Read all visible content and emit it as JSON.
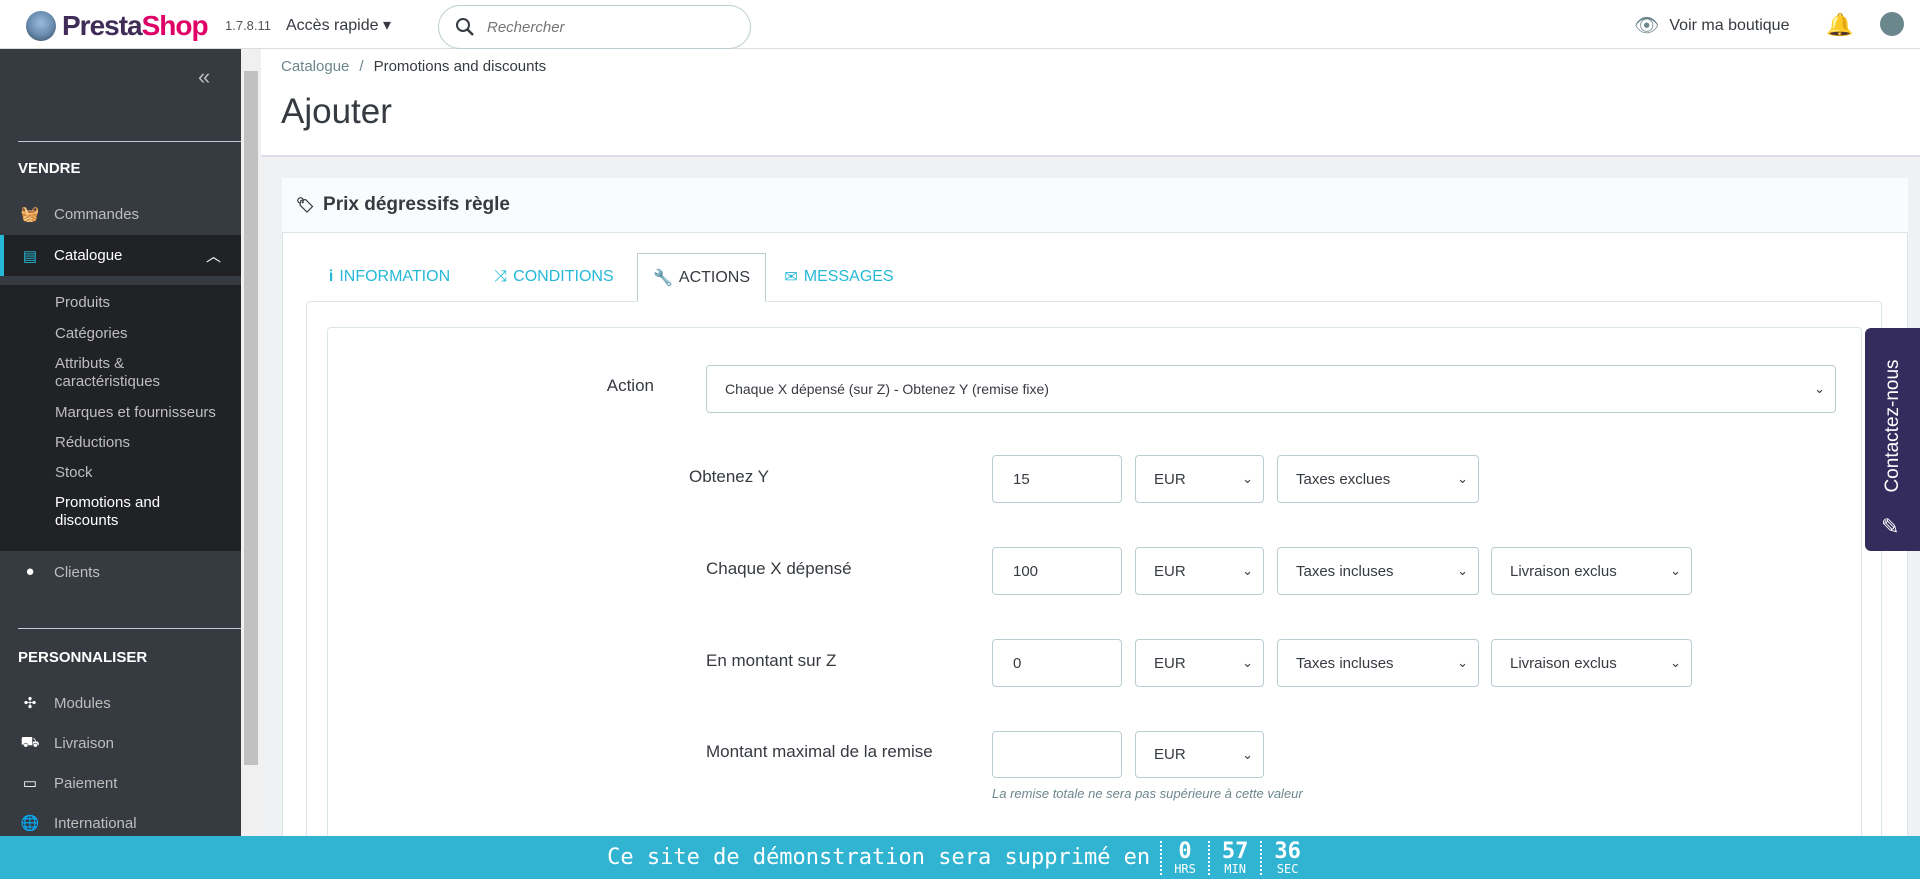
{
  "header": {
    "brand": "PrestaShop",
    "version": "1.7.8.11",
    "quick_access": "Accès rapide",
    "search_placeholder": "Rechercher",
    "view_shop": "Voir ma boutique"
  },
  "sidebar": {
    "sections": [
      "VENDRE",
      "PERSONNALISER"
    ],
    "items": [
      {
        "label": "Commandes",
        "icon": "basket-icon"
      },
      {
        "label": "Catalogue",
        "icon": "store-icon"
      },
      {
        "label": "Clients",
        "icon": "account-icon"
      },
      {
        "label": "Modules",
        "icon": "puzzle-icon"
      },
      {
        "label": "Livraison",
        "icon": "truck-icon"
      },
      {
        "label": "Paiement",
        "icon": "credit-card-icon"
      },
      {
        "label": "International",
        "icon": "globe-icon"
      }
    ],
    "catalogue_sub": [
      "Produits",
      "Catégories",
      "Attributs & caractéristiques",
      "Marques et fournisseurs",
      "Réductions",
      "Stock",
      "Promotions and discounts"
    ]
  },
  "breadcrumb": [
    "Catalogue",
    "Promotions and discounts"
  ],
  "page_title": "Ajouter",
  "card_title": "Prix dégressifs règle",
  "tabs": [
    "INFORMATION",
    "CONDITIONS",
    "ACTIONS",
    "MESSAGES"
  ],
  "form": {
    "action_label": "Action",
    "action_value": "Chaque X dépensé (sur Z) - Obtenez Y (remise fixe)",
    "rows": [
      {
        "label": "Obtenez Y",
        "value": "15",
        "currency": "EUR",
        "tax": "Taxes exclues"
      },
      {
        "label": "Chaque X dépensé",
        "value": "100",
        "currency": "EUR",
        "tax": "Taxes incluses",
        "shipping": "Livraison exclus"
      },
      {
        "label": "En montant sur Z",
        "value": "0",
        "currency": "EUR",
        "tax": "Taxes incluses",
        "shipping": "Livraison exclus"
      },
      {
        "label": "Montant maximal de la remise",
        "value": "",
        "currency": "EUR"
      }
    ],
    "max_help": "La remise totale ne sera pas supérieure à cette valeur"
  },
  "contact": "Contactez-nous",
  "banner": {
    "text": "Ce site de démonstration sera supprimé en",
    "hours": "0",
    "hours_unit": "HRS",
    "minutes": "57",
    "minutes_unit": "MIN",
    "seconds": "36",
    "seconds_unit": "SEC"
  }
}
